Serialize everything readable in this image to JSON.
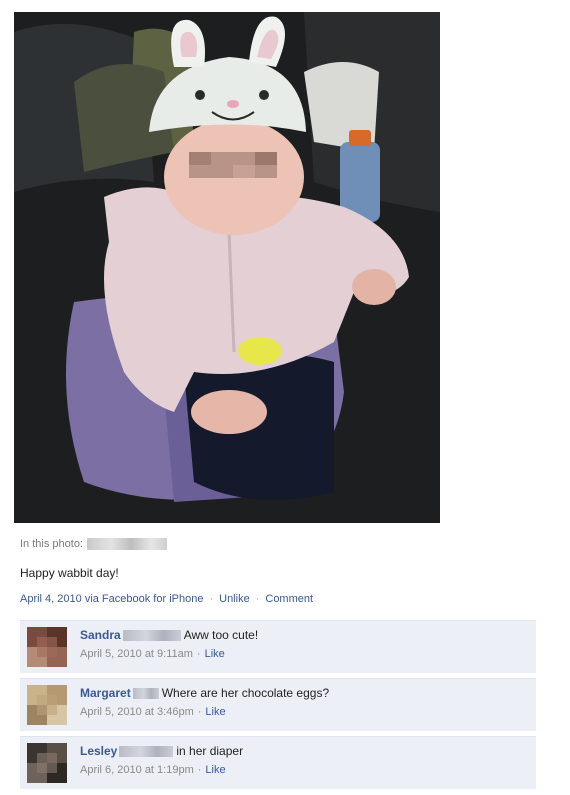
{
  "post": {
    "in_photo_label": "In this photo:",
    "caption": "Happy wabbit day!",
    "date": "April 4, 2010 via Facebook for iPhone",
    "unlike_label": "Unlike",
    "comment_label": "Comment"
  },
  "comments": [
    {
      "name": "Sandra",
      "text": "Aww too cute!",
      "time": "April 5, 2010 at 9:11am",
      "like_label": "Like"
    },
    {
      "name": "Margaret",
      "text": "Where are her chocolate eggs?",
      "time": "April 5, 2010 at 3:46pm",
      "like_label": "Like"
    },
    {
      "name": "Lesley",
      "text": "in her diaper",
      "time": "April 6, 2010 at 1:19pm",
      "like_label": "Like"
    }
  ],
  "colors": {
    "link": "#3b5998",
    "comment_bg": "#eceff5",
    "meta": "#8a8a8a"
  },
  "icons": {
    "separator": "middle-dot"
  }
}
